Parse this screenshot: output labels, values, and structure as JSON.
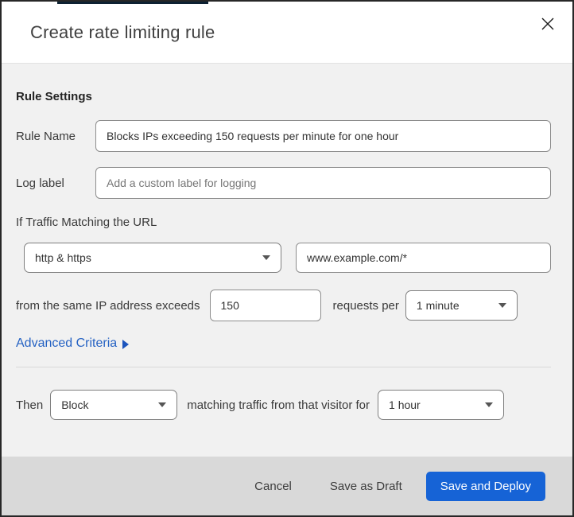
{
  "dialog": {
    "title": "Create rate limiting rule"
  },
  "rule_settings": {
    "heading": "Rule Settings",
    "rule_name": {
      "label": "Rule Name",
      "value": "Blocks IPs exceeding 150 requests per minute for one hour"
    },
    "log_label": {
      "label": "Log label",
      "placeholder": "Add a custom label for logging"
    }
  },
  "traffic_match": {
    "heading": "If Traffic Matching the URL",
    "scheme_select": {
      "value": "http & https"
    },
    "url_input": {
      "value": "www.example.com/*"
    },
    "condition": {
      "prefix": "from the same IP address exceeds",
      "threshold": "150",
      "middle": "requests per",
      "period_select": {
        "value": "1 minute"
      }
    },
    "advanced_link": "Advanced Criteria"
  },
  "action": {
    "prefix": "Then",
    "action_select": {
      "value": "Block"
    },
    "middle": "matching traffic from that visitor for",
    "duration_select": {
      "value": "1 hour"
    }
  },
  "footer": {
    "cancel": "Cancel",
    "save_draft": "Save as Draft",
    "save_deploy": "Save and Deploy"
  },
  "colors": {
    "primary_blue": "#1663d6",
    "link_blue": "#2562c3",
    "footer_gray": "#d9d9d9",
    "body_gray": "#f1f1f1",
    "top_strip_navy": "#0d2132"
  }
}
